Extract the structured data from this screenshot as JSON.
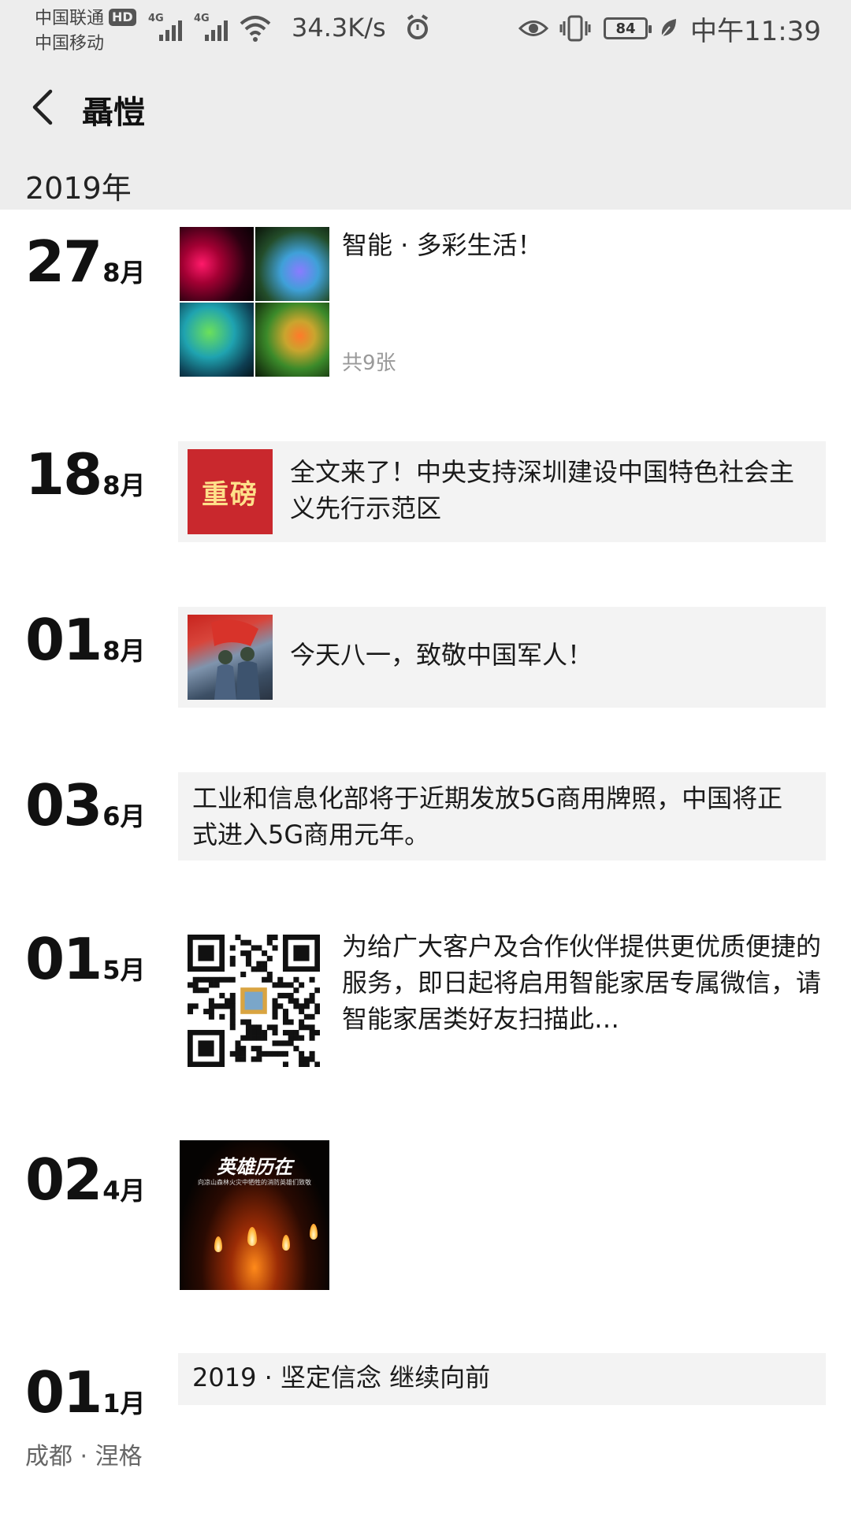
{
  "status_bar": {
    "carrier_1": "中国联通",
    "hd_badge": "HD",
    "carrier_2": "中国移动",
    "network_1": "4G",
    "network_2": "4G",
    "net_speed": "34.3K/s",
    "battery": "84",
    "time": "中午11:39",
    "icons": [
      "signal-icon",
      "wifi-icon",
      "alarm-icon",
      "eye-icon",
      "vibrate-icon",
      "battery-icon",
      "leaf-icon"
    ]
  },
  "header": {
    "back_icon": "chevron-left-icon",
    "title": "聶愷"
  },
  "year_label": "2019年",
  "posts": [
    {
      "day": "27",
      "month": "8月",
      "text": "智能 · 多彩生活！",
      "photo_count": "共9张"
    },
    {
      "day": "18",
      "month": "8月",
      "thumb_text": "重磅",
      "text": "全文来了！中央支持深圳建设中国特色社会主义先行示范区"
    },
    {
      "day": "01",
      "month": "8月",
      "text": "今天八一，致敬中国军人！"
    },
    {
      "day": "03",
      "month": "6月",
      "text": "工业和信息化部将于近期发放5G商用牌照，中国将正式进入5G商用元年。"
    },
    {
      "day": "01",
      "month": "5月",
      "text": "为给广大客户及合作伙伴提供更优质便捷的服务，即日起将启用智能家居专属微信，请智能家居类好友扫描此…"
    },
    {
      "day": "02",
      "month": "4月",
      "image_title": "英雄历在",
      "image_subtitle": "向凉山森林火灾中牺牲的消防英雄们致敬"
    },
    {
      "day": "01",
      "month": "1月",
      "text": "2019 · 坚定信念 继续向前",
      "location": "成都 · 涅格"
    }
  ]
}
